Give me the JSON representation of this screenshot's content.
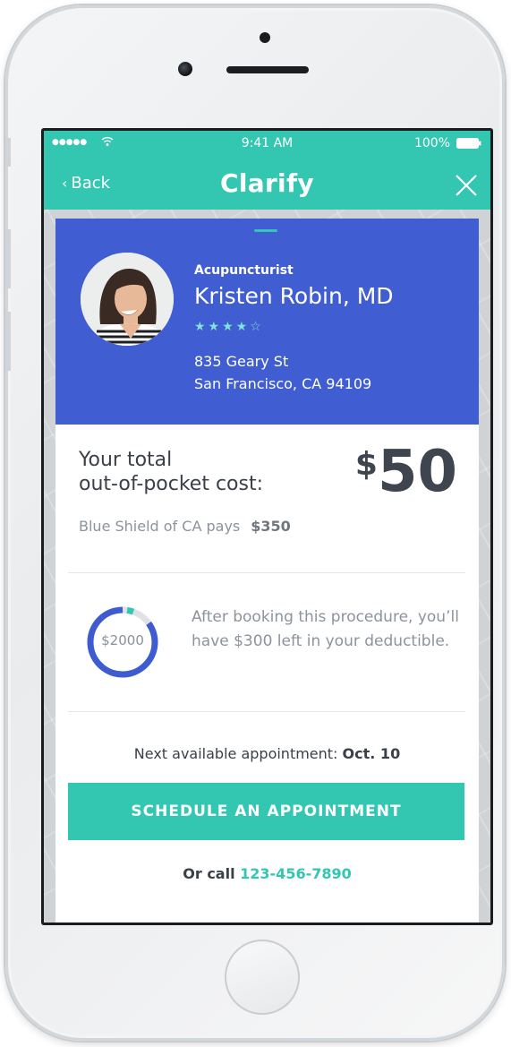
{
  "status_bar": {
    "signal": "●●●●●",
    "time": "9:41 AM",
    "battery": "100%"
  },
  "nav": {
    "back_label": "Back",
    "title": "Clarify"
  },
  "doctor": {
    "specialty": "Acupuncturist",
    "name": "Kristen Robin, MD",
    "rating_stars": "★★★★☆",
    "address_line1": "835 Geary St",
    "address_line2": "San Francisco, CA 94109"
  },
  "cost": {
    "label_line1": "Your total",
    "label_line2": "out-of-pocket cost:",
    "currency": "$",
    "amount": "50",
    "insurer_text": "Blue Shield of CA pays",
    "insurer_amount": "$350"
  },
  "deductible": {
    "total_label": "$2000",
    "remaining_fraction": 0.85,
    "message": "After booking this procedure, you’ll have $300 left in your deductible."
  },
  "appointment": {
    "prefix": "Next available appointment:",
    "date": "Oct. 10",
    "button_label": "SCHEDULE AN APPOINTMENT",
    "call_prefix": "Or call",
    "phone": "123-456-7890"
  },
  "colors": {
    "teal": "#33c6b1",
    "blue": "#405dd2",
    "donut_blue": "#3f5bd0",
    "donut_track": "#dfe2e5"
  }
}
